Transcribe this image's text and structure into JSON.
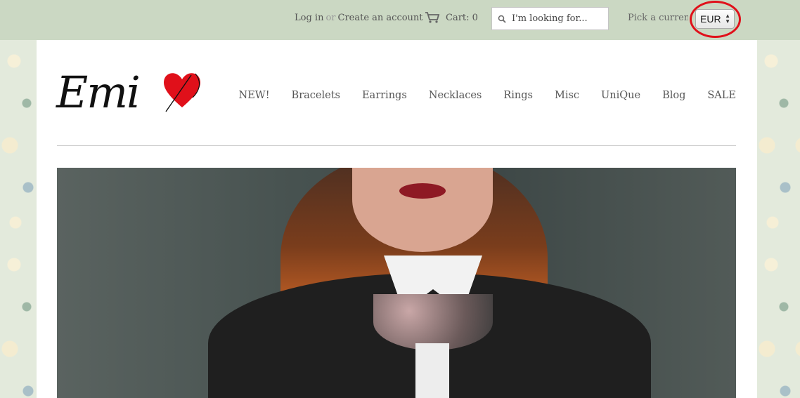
{
  "topbar": {
    "login": "Log in",
    "or": "or",
    "create_account": "Create an account",
    "cart": "Cart: 0",
    "search_placeholder": "I'm looking for...",
    "currency_label": "Pick a currency",
    "currency_value": "EUR",
    "highlight_color": "#e0101a"
  },
  "logo": {
    "text": "Emi",
    "heart_color": "#e0101a"
  },
  "nav": {
    "items": [
      "NEW!",
      "Bracelets",
      "Earrings",
      "Necklaces",
      "Rings",
      "Misc",
      "UniQue",
      "Blog",
      "SALE"
    ]
  },
  "colors": {
    "topbar_bg": "#cbd8c3",
    "page_bg": "#ffffff"
  }
}
